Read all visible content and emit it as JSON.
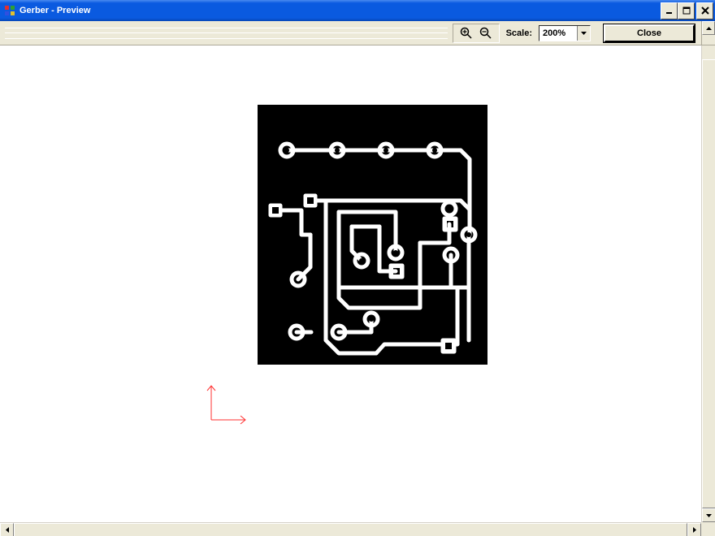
{
  "window": {
    "title": "Gerber - Preview"
  },
  "toolbar": {
    "scale_label": "Scale:",
    "scale_value": "200%",
    "close_label": "Close"
  }
}
